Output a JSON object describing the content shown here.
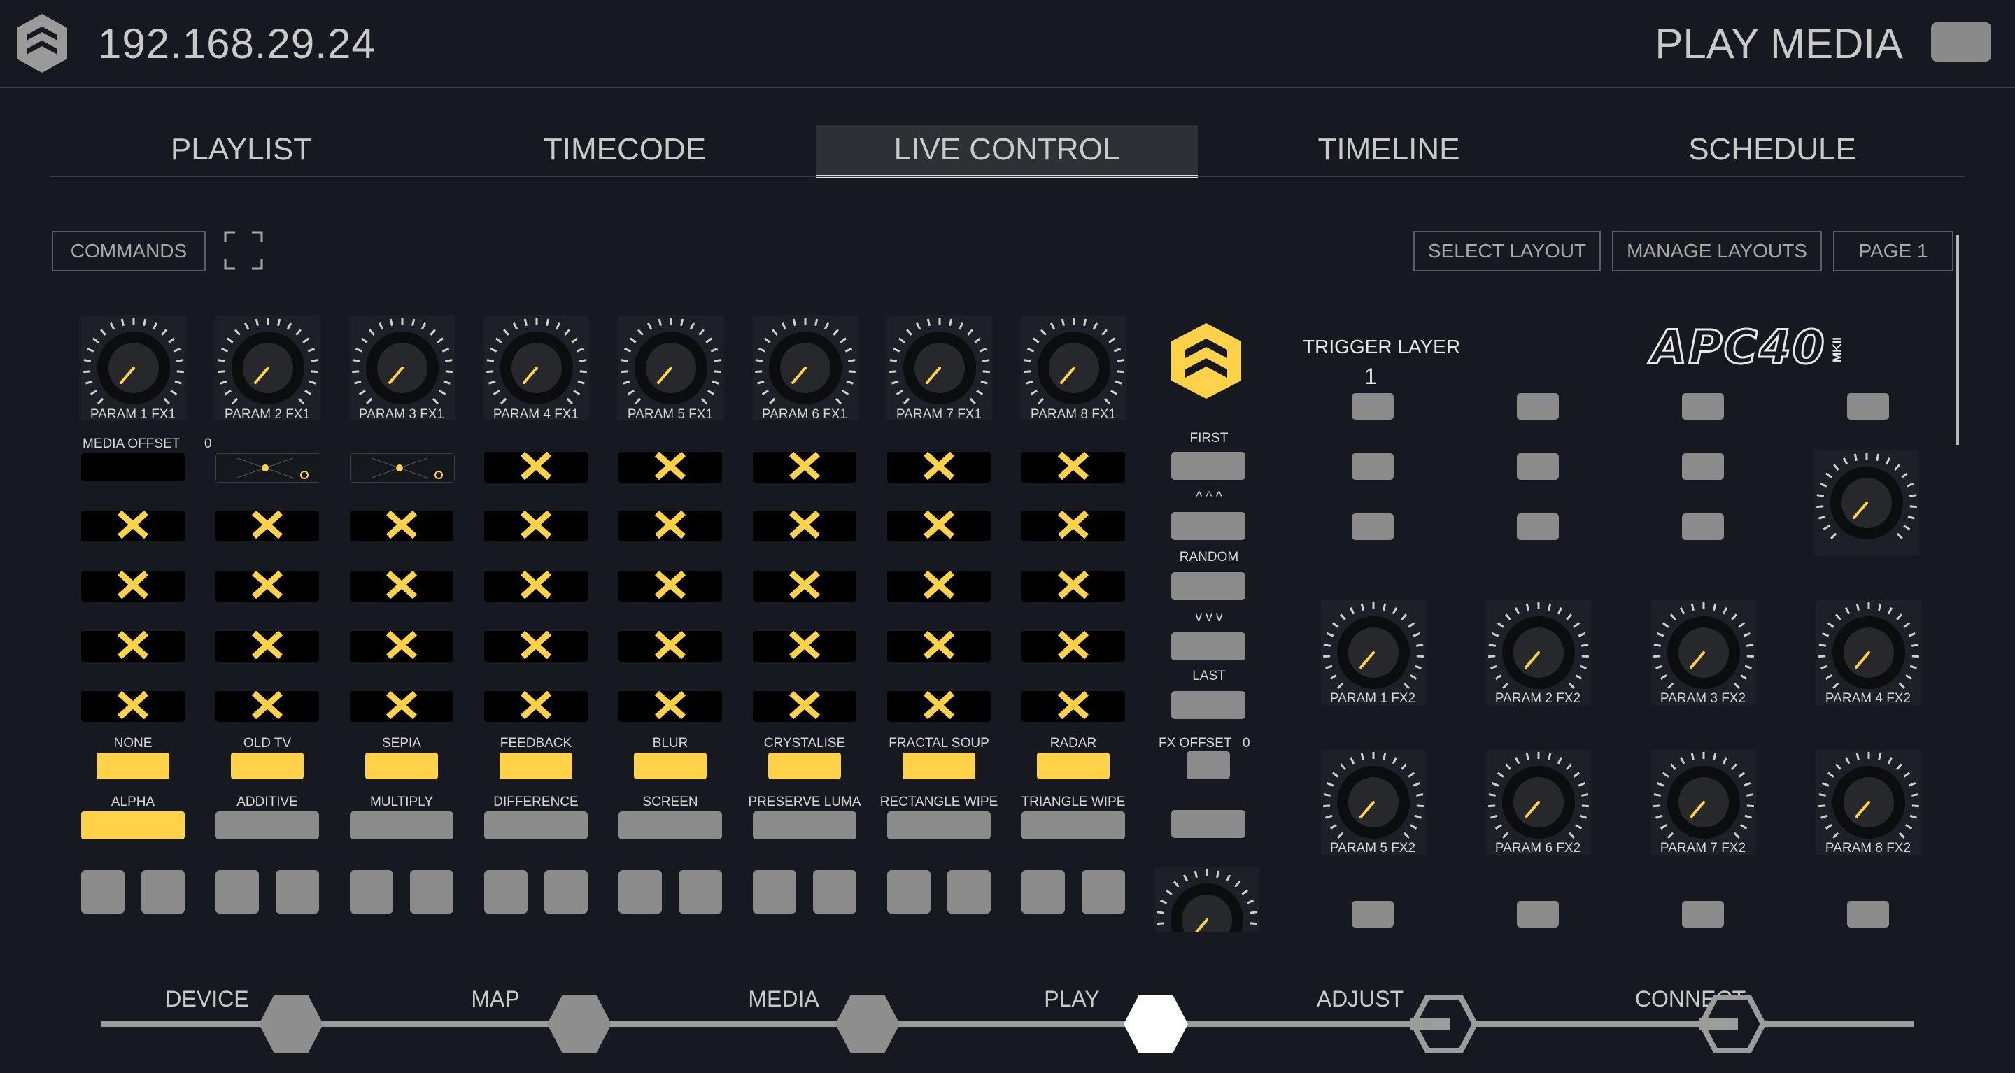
{
  "header": {
    "ip_address": "192.168.29.24",
    "mode_title": "PLAY MEDIA",
    "logo_icon": "wb-logo-icon"
  },
  "tabs": [
    {
      "label": "PLAYLIST",
      "active": false
    },
    {
      "label": "TIMECODE",
      "active": false
    },
    {
      "label": "LIVE CONTROL",
      "active": true
    },
    {
      "label": "TIMELINE",
      "active": false
    },
    {
      "label": "SCHEDULE",
      "active": false
    }
  ],
  "toolbar": {
    "commands_label": "COMMANDS",
    "fullscreen_icon": "fullscreen-icon",
    "select_layout_label": "SELECT LAYOUT",
    "manage_layouts_label": "MANAGE LAYOUTS",
    "page_label": "PAGE 1"
  },
  "fx1_params": [
    "PARAM 1 FX1",
    "PARAM 2 FX1",
    "PARAM 3 FX1",
    "PARAM 4 FX1",
    "PARAM 5 FX1",
    "PARAM 6 FX1",
    "PARAM 7 FX1",
    "PARAM 8 FX1"
  ],
  "media_offset": {
    "label": "MEDIA OFFSET",
    "value": "0"
  },
  "effects": [
    "NONE",
    "OLD TV",
    "SEPIA",
    "FEEDBACK",
    "BLUR",
    "CRYSTALISE",
    "FRACTAL SOUP",
    "RADAR"
  ],
  "active_effect": "NONE",
  "blends": [
    "ALPHA",
    "ADDITIVE",
    "MULTIPLY",
    "DIFFERENCE",
    "SCREEN",
    "PRESERVE LUMA",
    "RECTANGLE WIPE",
    "TRIANGLE WIPE"
  ],
  "active_blend": "ALPHA",
  "side_controls": {
    "first": "FIRST",
    "up": "^ ^ ^",
    "random": "RANDOM",
    "down": "v v v",
    "last": "LAST",
    "fx_offset_label": "FX OFFSET",
    "fx_offset_value": "0"
  },
  "trigger_layer": {
    "label": "TRIGGER LAYER",
    "value": "1"
  },
  "device_logo_text": "APC40",
  "device_logo_suffix": "MKII",
  "fx2_params": [
    "PARAM 1 FX2",
    "PARAM 2 FX2",
    "PARAM 3 FX2",
    "PARAM 4 FX2",
    "PARAM 5 FX2",
    "PARAM 6 FX2",
    "PARAM 7 FX2",
    "PARAM 8 FX2"
  ],
  "nav": [
    {
      "label": "DEVICE",
      "state": "done"
    },
    {
      "label": "MAP",
      "state": "done"
    },
    {
      "label": "MEDIA",
      "state": "done"
    },
    {
      "label": "PLAY",
      "state": "current"
    },
    {
      "label": "ADJUST",
      "state": "link"
    },
    {
      "label": "CONNECT",
      "state": "link"
    }
  ],
  "colors": {
    "accent": "#ffd24a",
    "background": "#161a20",
    "button_gray": "#8b8b8b"
  }
}
